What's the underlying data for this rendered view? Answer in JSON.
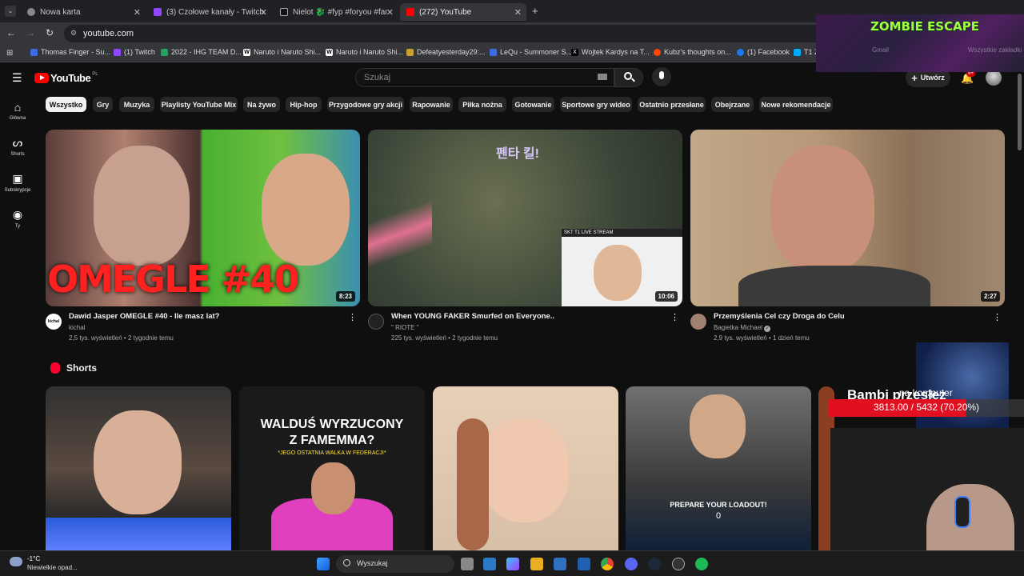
{
  "browser": {
    "tabs": [
      {
        "title": "Nowa karta",
        "active": false
      },
      {
        "title": "(3) Czołowe kanały - Twitch",
        "active": false
      },
      {
        "title": "Nielot 🐉 #fyp #foryou #fame",
        "active": false
      },
      {
        "title": "(272) YouTube",
        "active": true
      }
    ],
    "new_tab": "+",
    "url": "youtube.com",
    "bookmarks": [
      "Thomas Finger - Su...",
      "(1) Twitch",
      "2022 - IHG TEAM D...",
      "Naruto i Naruto Shi...",
      "Naruto i Naruto Shi...",
      "Defeatyesterday29:...",
      "LeQu - Summoner S...",
      "Wojtek Kardys na T...",
      "Kubz's thoughts on...",
      "(1) Facebook",
      "T1 Z"
    ]
  },
  "youtube": {
    "logo": "YouTube",
    "country": "PL",
    "search_placeholder": "Szukaj",
    "create_label": "Utwórz",
    "notif_badge": "9+",
    "sidebar": [
      {
        "label": "Główna",
        "icon": "home-icon"
      },
      {
        "label": "Shorts",
        "icon": "shorts-icon"
      },
      {
        "label": "Subskrypcje",
        "icon": "subscriptions-icon"
      },
      {
        "label": "Ty",
        "icon": "you-icon"
      }
    ],
    "chips": [
      "Wszystko",
      "Gry",
      "Muzyka",
      "Playlisty YouTube Mix",
      "Na żywo",
      "Hip-hop",
      "Przygodowe gry akcji",
      "Rapowanie",
      "Piłka nożna",
      "Gotowanie",
      "Sportowe gry wideo",
      "Ostatnio przesłane",
      "Obejrzane",
      "Nowe rekomendacje"
    ],
    "videos": [
      {
        "title": "Dawid Jasper OMEGLE #40 - Ile masz lat?",
        "channel": "kichal",
        "meta": "2,5 tys. wyświetleń • 2 tygodnie temu",
        "duration": "8:23",
        "thumb_text": "OMEGLE #40",
        "avatar_text": "kichal"
      },
      {
        "title": "When YOUNG FAKER Smurfed on Everyone..",
        "channel": "\" RIOTE \"",
        "meta": "225 tys. wyświetleń • 2 tygodnie temu",
        "duration": "10:06",
        "thumb_text": "펜타 킬!",
        "thumb_sub": "SKT T1 LIVE STREAM"
      },
      {
        "title": "Przemyślenia Cel czy Droga do Celu",
        "channel": "Bagietka Michael",
        "meta": "2,9 tys. wyświetleń • 1 dzień temu",
        "duration": "2:27",
        "verified": true
      }
    ],
    "shorts_title": "Shorts",
    "shorts": [
      {
        "text": ""
      },
      {
        "text": "WALDUŚ WYRZUCONY Z FAMEMMA?",
        "sub": "*JEGO OSTATNIA WALKA W FEDERACJI*"
      },
      {
        "text": ""
      },
      {
        "text": "PREPARE YOUR LOADOUT!",
        "sub": "0"
      },
      {
        "text": "Bambi przesłez"
      }
    ]
  },
  "overlay": {
    "zombie_title": "ZOMBIE ESCAPE",
    "bar_label": "na komputer",
    "bar_value": "3813.00 / 5432 (70.20%)",
    "bar_fraction": 0.702,
    "faint_bookmarks": [
      "Gmail",
      "Wszystkie zakładki"
    ]
  },
  "taskbar": {
    "weather_temp": "-1°C",
    "weather_desc": "Niewielkie opad...",
    "search_label": "Wyszukaj"
  },
  "colors": {
    "yt_red": "#ff0000",
    "bg": "#0f0f0f",
    "chip": "#272727",
    "overlay_bar": "#e01020"
  }
}
